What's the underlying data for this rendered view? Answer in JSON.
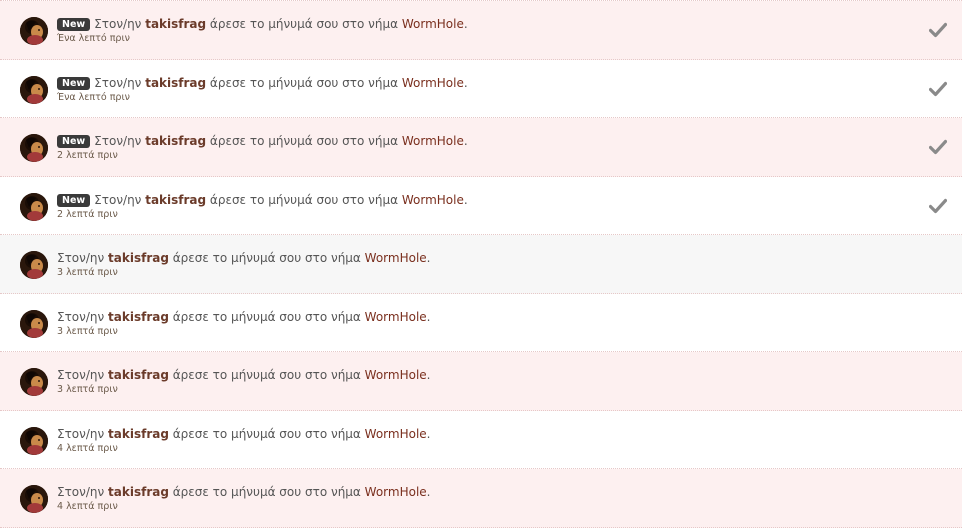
{
  "colors": {
    "row_pink": "#fdf0f0",
    "row_grey": "#f7f7f7",
    "row_white": "#ffffff",
    "badge_bg": "#3a3a3a",
    "username": "#6b3b2a",
    "thread_link": "#7a2f1e",
    "check_icon": "#8a8a8a"
  },
  "alerts": [
    {
      "bg": "pink",
      "new": true,
      "badge": "New",
      "pre": "Στον/ην ",
      "user": "takisfrag",
      "mid": " άρεσε το μήνυμά σου στο νήμα ",
      "thread": "WormHole",
      "post": ".",
      "time": "Ένα λεπτό πριν",
      "check_icon": "checkmark-icon"
    },
    {
      "bg": "white",
      "new": true,
      "badge": "New",
      "pre": "Στον/ην ",
      "user": "takisfrag",
      "mid": " άρεσε το μήνυμά σου στο νήμα ",
      "thread": "WormHole",
      "post": ".",
      "time": "Ένα λεπτό πριν",
      "check_icon": "checkmark-icon"
    },
    {
      "bg": "pink",
      "new": true,
      "badge": "New",
      "pre": "Στον/ην ",
      "user": "takisfrag",
      "mid": " άρεσε το μήνυμά σου στο νήμα ",
      "thread": "WormHole",
      "post": ".",
      "time": "2 λεπτά πριν",
      "check_icon": "checkmark-icon"
    },
    {
      "bg": "white",
      "new": true,
      "badge": "New",
      "pre": "Στον/ην ",
      "user": "takisfrag",
      "mid": " άρεσε το μήνυμά σου στο νήμα ",
      "thread": "WormHole",
      "post": ".",
      "time": "2 λεπτά πριν",
      "check_icon": "checkmark-icon"
    },
    {
      "bg": "grey",
      "new": false,
      "badge": "",
      "pre": "Στον/ην ",
      "user": "takisfrag",
      "mid": " άρεσε το μήνυμά σου στο νήμα ",
      "thread": "WormHole",
      "post": ".",
      "time": "3 λεπτά πριν",
      "check_icon": ""
    },
    {
      "bg": "white",
      "new": false,
      "badge": "",
      "pre": "Στον/ην ",
      "user": "takisfrag",
      "mid": " άρεσε το μήνυμά σου στο νήμα ",
      "thread": "WormHole",
      "post": ".",
      "time": "3 λεπτά πριν",
      "check_icon": ""
    },
    {
      "bg": "pink",
      "new": false,
      "badge": "",
      "pre": "Στον/ην ",
      "user": "takisfrag",
      "mid": " άρεσε το μήνυμά σου στο νήμα ",
      "thread": "WormHole",
      "post": ".",
      "time": "3 λεπτά πριν",
      "check_icon": ""
    },
    {
      "bg": "white",
      "new": false,
      "badge": "",
      "pre": "Στον/ην ",
      "user": "takisfrag",
      "mid": " άρεσε το μήνυμά σου στο νήμα ",
      "thread": "WormHole",
      "post": ".",
      "time": "4 λεπτά πριν",
      "check_icon": ""
    },
    {
      "bg": "pink",
      "new": false,
      "badge": "",
      "pre": "Στον/ην ",
      "user": "takisfrag",
      "mid": " άρεσε το μήνυμά σου στο νήμα ",
      "thread": "WormHole",
      "post": ".",
      "time": "4 λεπτά πριν",
      "check_icon": ""
    }
  ]
}
